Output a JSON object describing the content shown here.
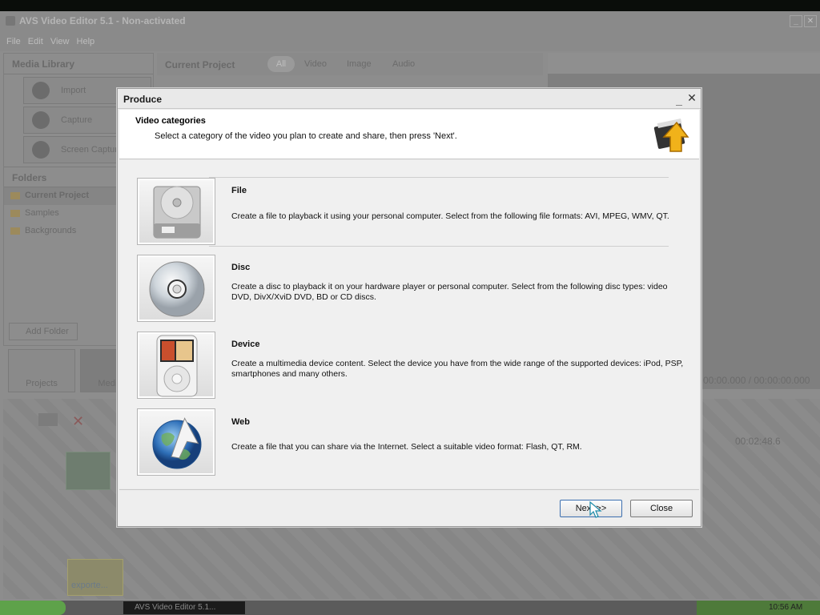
{
  "app": {
    "title": "AVS Video Editor 5.1 - Non-activated",
    "menu": [
      "File",
      "Edit",
      "View",
      "Help"
    ],
    "media_library": {
      "heading": "Media Library",
      "buttons": [
        "Import",
        "Capture",
        "Screen Captur"
      ],
      "folders_heading": "Folders",
      "folders": [
        "Current Project",
        "Samples",
        "Backgrounds"
      ],
      "add_folder": "Add Folder"
    },
    "current_project": {
      "heading": "Current Project",
      "filters": [
        "All",
        "Video",
        "Image",
        "Audio"
      ]
    },
    "preview": {
      "timecode": "00:00.000 / 00:00:00.000",
      "ruler_time": "00:02:48.6"
    },
    "bottom_tabs": [
      "Projects",
      "Media L"
    ],
    "timeline": {
      "clip_label": "exporte..."
    }
  },
  "taskbar": {
    "task_label": "AVS Video Editor 5.1...",
    "clock": "10:56 AM"
  },
  "dialog": {
    "title": "Produce",
    "header_title": "Video categories",
    "header_subtitle": "Select a category of the video you plan to create and share, then press 'Next'.",
    "categories": [
      {
        "title": "File",
        "description": "Create a file to playback it using your personal computer. Select from the following file formats: AVI, MPEG, WMV, QT.",
        "icon": "hard-drive-icon"
      },
      {
        "title": "Disc",
        "description": "Create a disc to playback it on your hardware player or personal computer. Select from the following disc types: video DVD, DivX/XviD DVD, BD or CD discs.",
        "icon": "disc-icon"
      },
      {
        "title": "Device",
        "description": "Create a multimedia device content. Select the device you have from the wide range of the supported devices: iPod, PSP, smartphones and many others.",
        "icon": "ipod-icon"
      },
      {
        "title": "Web",
        "description": "Create a file that you can share via the Internet. Select a suitable video format: Flash, QT, RM.",
        "icon": "globe-icon"
      }
    ],
    "buttons": {
      "next": "Next >>",
      "close": "Close"
    }
  }
}
